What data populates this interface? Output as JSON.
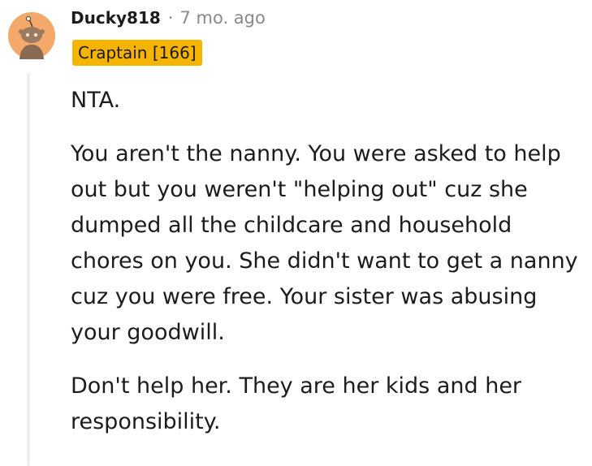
{
  "comment": {
    "username": "Ducky818",
    "separator": "·",
    "timestamp": "7 mo. ago",
    "flair": "Craptain [166]",
    "paragraphs": [
      "NTA.",
      "You aren't the nanny. You were asked to help out but you weren't \"helping out\" cuz she dumped all the childcare and household chores on you. She didn't want to get a nanny cuz you were free. Your sister was abusing your goodwill.",
      "Don't help her. They are her kids and her responsibility."
    ]
  },
  "colors": {
    "flair_bg": "#f5b400",
    "avatar_bg": "#f4a96a",
    "thread_line": "#edeff1",
    "meta_text": "#878a8c"
  },
  "icons": {
    "avatar": "snoo-avatar-icon"
  }
}
